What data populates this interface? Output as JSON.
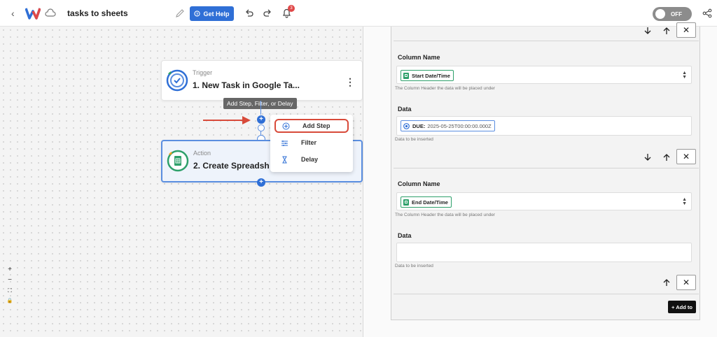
{
  "header": {
    "title": "tasks to sheets",
    "help_label": "Get Help",
    "notification_count": "3",
    "toggle_label": "OFF"
  },
  "canvas": {
    "trigger": {
      "kind": "Trigger",
      "name": "1. New Task in Google Ta..."
    },
    "action": {
      "kind": "Action",
      "name": "2. Create Spreadsh"
    },
    "tooltip": "Add Step, Filter, or Delay",
    "menu": [
      {
        "label": "Add Step",
        "icon": "plus-circle-icon"
      },
      {
        "label": "Filter",
        "icon": "filter-icon"
      },
      {
        "label": "Delay",
        "icon": "hourglass-icon"
      }
    ],
    "zoom": [
      "+",
      "−",
      "⛶",
      "🔒"
    ]
  },
  "panel": {
    "rows": [
      {
        "column_label": "Column Name",
        "column_value": "Start Date/Time",
        "column_hint": "The Column Header the data will be placed under",
        "data_label": "Data",
        "data_prefix": "DUE:",
        "data_value": "2025-05-25T00:00:00.000Z",
        "data_hint": "Data to be inserted"
      },
      {
        "column_label": "Column Name",
        "column_value": "End Date/Time",
        "column_hint": "The Column Header the data will be placed under",
        "data_label": "Data",
        "data_value": "",
        "data_hint": "Data to be inserted"
      }
    ],
    "add_button": "+ Add to"
  },
  "colors": {
    "accent": "#2f6fd6",
    "highlight": "#d84a3a",
    "sheets_green": "#2ea06a"
  }
}
